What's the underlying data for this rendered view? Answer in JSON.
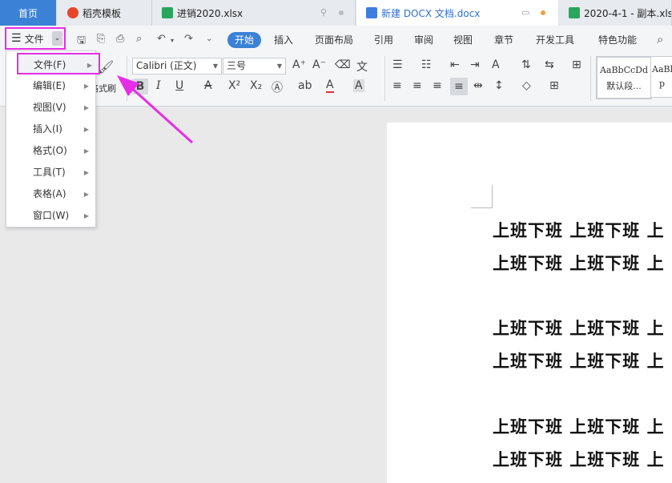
{
  "tabs": [
    {
      "label": "首页"
    },
    {
      "label": "稻壳模板"
    },
    {
      "label": "进销2020.xlsx"
    },
    {
      "label": "新建 DOCX 文档.docx"
    },
    {
      "label": "2020-4-1 - 副本.xls"
    }
  ],
  "file_button": {
    "label": "文件"
  },
  "ribbon_tabs": [
    "开始",
    "插入",
    "页面布局",
    "引用",
    "审阅",
    "视图",
    "章节",
    "开发工具",
    "特色功能"
  ],
  "font": {
    "name": "Calibri (正文)",
    "size": "三号"
  },
  "format_painter": "格式刷",
  "styles": [
    {
      "preview": "AaBbCcDd",
      "label": "默认段..."
    },
    {
      "preview": "AaBl",
      "label": "p"
    }
  ],
  "menu": [
    {
      "label": "文件(F)"
    },
    {
      "label": "编辑(E)"
    },
    {
      "label": "视图(V)"
    },
    {
      "label": "插入(I)"
    },
    {
      "label": "格式(O)"
    },
    {
      "label": "工具(T)"
    },
    {
      "label": "表格(A)"
    },
    {
      "label": "窗口(W)"
    }
  ],
  "doc_lines": [
    "上班下班  上班下班  上",
    "上班下班  上班下班  上",
    "上班下班  上班下班  上",
    "上班下班  上班下班  上",
    "上班下班  上班下班  上",
    "上班下班  上班下班  上"
  ],
  "colors": {
    "accent": "#3b82d6",
    "highlight": "#e62ee6"
  }
}
